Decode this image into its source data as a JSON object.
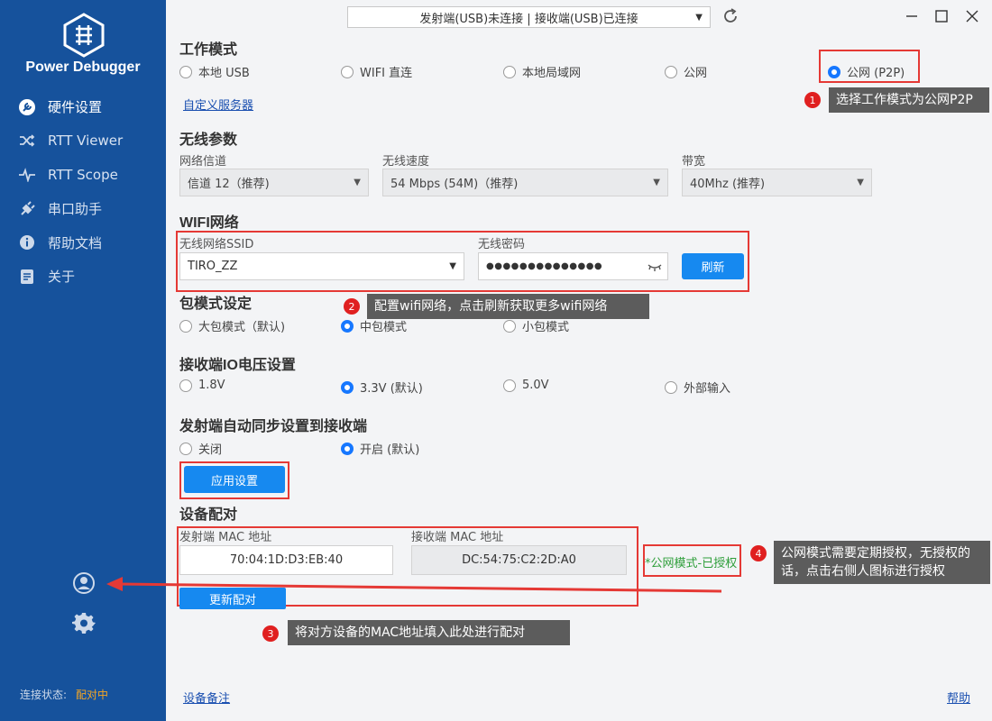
{
  "app": {
    "name": "Power Debugger"
  },
  "nav": [
    {
      "label": "硬件设置",
      "icon": "hardware-wrench-icon",
      "active": true
    },
    {
      "label": "RTT Viewer",
      "icon": "shuffle-icon",
      "active": false
    },
    {
      "label": "RTT Scope",
      "icon": "pulse-icon",
      "active": false
    },
    {
      "label": "串口助手",
      "icon": "plug-icon",
      "active": false
    },
    {
      "label": "帮助文档",
      "icon": "info-icon",
      "active": false
    },
    {
      "label": "关于",
      "icon": "document-icon",
      "active": false
    }
  ],
  "sidebar_footer": {
    "label": "连接状态:",
    "value": "配对中"
  },
  "topbar": {
    "status": "发射端(USB)未连接 | 接收端(USB)已连接"
  },
  "work_mode": {
    "title": "工作模式",
    "options": [
      "本地 USB",
      "WIFI 直连",
      "本地局域网",
      "公网",
      "公网 (P2P)"
    ],
    "selected": "公网 (P2P)",
    "custom_server_link": "自定义服务器"
  },
  "wireless": {
    "title": "无线参数",
    "channel_label": "网络信道",
    "channel_value": "信道 12（推荐)",
    "speed_label": "无线速度",
    "speed_value": "54 Mbps (54M)（推荐)",
    "bandwidth_label": "带宽",
    "bandwidth_value": "40Mhz (推荐)"
  },
  "wifi": {
    "title": "WIFI网络",
    "ssid_label": "无线网络SSID",
    "ssid_value": "TIRO_ZZ",
    "password_label": "无线密码",
    "password_value": "●●●●●●●●●●●●●●",
    "refresh_label": "刷新"
  },
  "packet_mode": {
    "title": "包模式设定",
    "options": [
      "大包模式（默认)",
      "中包模式",
      "小包模式"
    ],
    "selected": "中包模式"
  },
  "io_voltage": {
    "title": "接收端IO电压设置",
    "options": [
      "1.8V",
      "3.3V (默认)",
      "5.0V",
      "外部输入"
    ],
    "selected": "3.3V (默认)"
  },
  "sync": {
    "title": "发射端自动同步设置到接收端",
    "options": [
      "关闭",
      "开启 (默认)"
    ],
    "selected": "开启 (默认)"
  },
  "apply_label": "应用设置",
  "pairing": {
    "title": "设备配对",
    "tx_mac_label": "发射端 MAC 地址",
    "tx_mac_value": "70:04:1D:D3:EB:40",
    "rx_mac_label": "接收端 MAC 地址",
    "rx_mac_value": "DC:54:75:C2:2D:A0",
    "update_label": "更新配对",
    "auth_status": "*公网模式-已授权"
  },
  "footer": {
    "device_note_link": "设备备注",
    "help_link": "帮助"
  },
  "callouts": [
    {
      "num": "1",
      "text": "选择工作模式为公网P2P"
    },
    {
      "num": "2",
      "text": "配置wifi网络，点击刷新获取更多wifi网络"
    },
    {
      "num": "3",
      "text": "将对方设备的MAC地址填入此处进行配对"
    },
    {
      "num": "4",
      "text": "公网模式需要定期授权，无授权的话，点击右侧人图标进行授权"
    }
  ],
  "colors": {
    "sidebar": "#16529c",
    "accent": "#1689f0",
    "annotation": "#e53935",
    "authorized": "#2e9e3a",
    "pairing_status": "#f5a623"
  }
}
